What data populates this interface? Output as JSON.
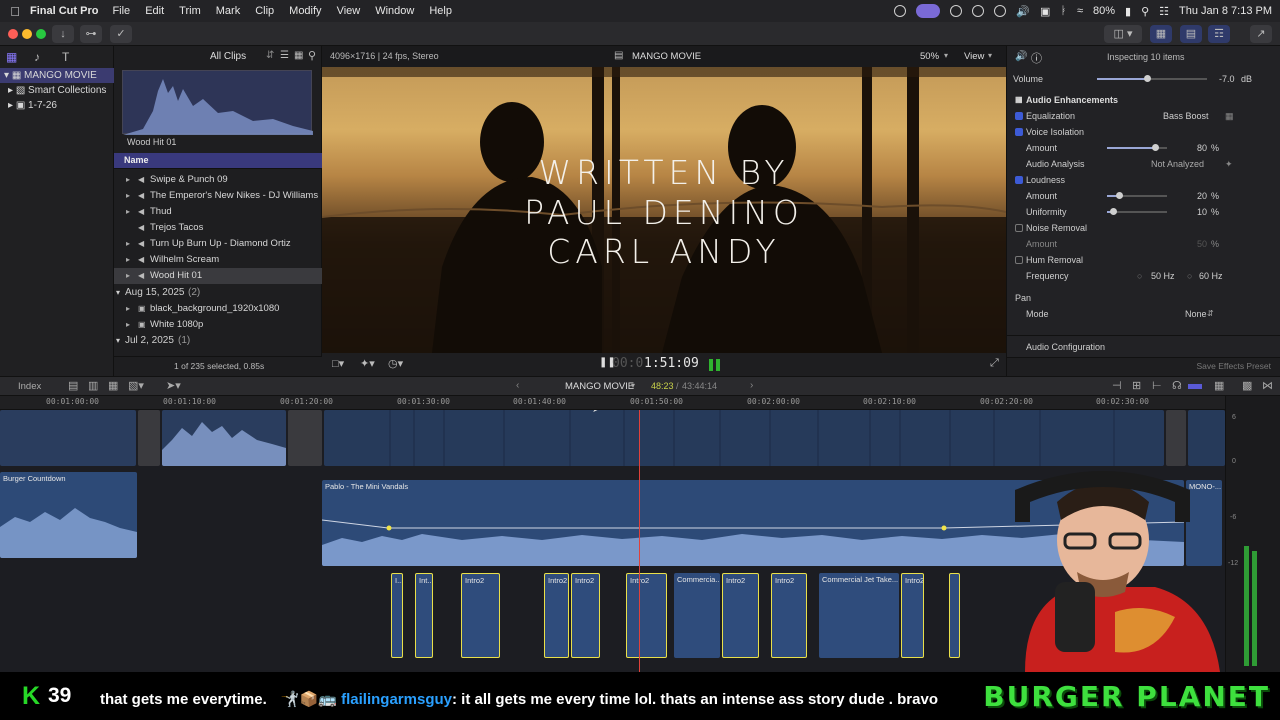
{
  "menubar": {
    "app_name": "Final Cut Pro",
    "items": [
      "File",
      "Edit",
      "Trim",
      "Mark",
      "Clip",
      "Modify",
      "View",
      "Window",
      "Help"
    ],
    "battery": "80%",
    "clock": "Thu Jan 8  7:13 PM"
  },
  "browser": {
    "filter_label": "All Clips",
    "libraries": [
      {
        "label": "MANGO MOVIE",
        "selected": true
      },
      {
        "label": "Smart Collections",
        "selected": false
      },
      {
        "label": "1-7-26",
        "selected": false
      }
    ],
    "thumbnail_label": "Wood Hit 01",
    "column_header": "Name",
    "rows": [
      {
        "label": "Swipe & Punch 09",
        "selected": false
      },
      {
        "label": "The Emperor's New Nikes - DJ Williams",
        "selected": false
      },
      {
        "label": "Thud",
        "selected": false
      },
      {
        "label": "Trejos Tacos",
        "selected": false
      },
      {
        "label": "Turn Up Burn Up - Diamond Ortiz",
        "selected": false
      },
      {
        "label": "Wilhelm Scream",
        "selected": false
      },
      {
        "label": "Wood Hit 01",
        "selected": true
      }
    ],
    "group1": {
      "label": "Aug 15, 2025",
      "count": "(2)"
    },
    "group1_rows": [
      "black_background_1920x1080",
      "White 1080p"
    ],
    "group2": {
      "label": "Jul 2, 2025",
      "count": "(1)"
    },
    "status": "1 of 235 selected, 0.85s"
  },
  "viewer": {
    "format": "4096×1716 | 24 fps, Stereo",
    "project": "MANGO MOVIE",
    "zoom": "50%",
    "view_menu": "View",
    "title_lines": [
      "WRITTEN BY",
      "PAUL DENINO",
      "CARL ANDY"
    ],
    "timecode_dim": "00:0",
    "timecode": "1:51:09"
  },
  "inspector": {
    "header": "Inspecting 10 items",
    "volume": {
      "label": "Volume",
      "value": "-7.0",
      "unit": "dB"
    },
    "section": "Audio Enhancements",
    "rows": {
      "equalization": {
        "label": "Equalization",
        "value": "Bass Boost"
      },
      "voice_isolation": {
        "label": "Voice Isolation"
      },
      "vi_amount": {
        "label": "Amount",
        "value": "80",
        "unit": "%"
      },
      "audio_analysis": {
        "label": "Audio Analysis",
        "value": "Not Analyzed"
      },
      "loudness": {
        "label": "Loudness"
      },
      "loud_amount": {
        "label": "Amount",
        "value": "20",
        "unit": "%"
      },
      "uniformity": {
        "label": "Uniformity",
        "value": "10",
        "unit": "%"
      },
      "noise_removal": {
        "label": "Noise Removal"
      },
      "nr_amount": {
        "label": "Amount",
        "value": "50",
        "unit": "%"
      },
      "hum_removal": {
        "label": "Hum Removal"
      },
      "frequency": {
        "label": "Frequency",
        "value1": "50 Hz",
        "value2": "60 Hz"
      },
      "pan": {
        "label": "Pan"
      },
      "mode": {
        "label": "Mode",
        "value": "None"
      }
    },
    "audio_config": "Audio Configuration",
    "save_preset": "Save Effects Preset",
    "sliders": {
      "volume": 0.45,
      "vi_amount": 0.8,
      "loud_amount": 0.2,
      "uniformity": 0.1
    }
  },
  "timeline": {
    "index": "Index",
    "project": "MANGO MOVIE",
    "position": "48:23",
    "duration": "43:44:14",
    "ruler": [
      "00:01:00:00",
      "00:01:10:00",
      "00:01:20:00",
      "00:01:30:00",
      "00:01:40:00",
      "00:01:50:00",
      "00:02:00:00",
      "00:02:10:00",
      "00:02:20:00",
      "00:02:30:00"
    ],
    "music_clip": "Pablo - The Mini Vandals",
    "left_clip": "Burger Countdown",
    "right_clip_a": "Mini V...",
    "right_clip_b": "MONO-...",
    "sfx_clips": [
      "I...",
      "Int...",
      "Intro2",
      "Intro2",
      "Intro2",
      "Intro2",
      "Commercia...",
      "Intro2",
      "Intro2",
      "Commercial Jet Take...",
      "Intro2",
      ""
    ],
    "meter_labels": [
      "6",
      "0",
      "-6",
      "-12"
    ]
  },
  "ticker": {
    "k": "K",
    "count": "39",
    "text_a": "that gets me everytime.",
    "emoji": "🤺📦🚌",
    "user": "flailingarmsguy",
    "text_b": ": it all gets me every time lol. thats an intense ass story dude . bravo",
    "brand": "BURGER PLANET"
  }
}
